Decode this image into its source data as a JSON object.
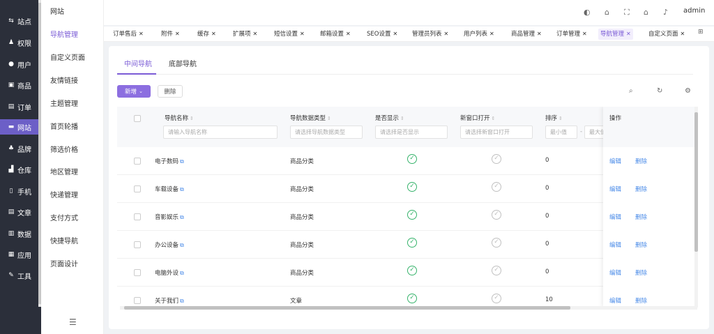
{
  "rail": {
    "items": [
      {
        "icon": "site-icon",
        "glyph": "⇆",
        "label": "站点"
      },
      {
        "icon": "permission-icon",
        "glyph": "♟",
        "label": "权限"
      },
      {
        "icon": "user-icon",
        "glyph": "●",
        "label": "用户"
      },
      {
        "icon": "product-icon",
        "glyph": "▣",
        "label": "商品"
      },
      {
        "icon": "order-icon",
        "glyph": "▤",
        "label": "订单"
      },
      {
        "icon": "website-icon",
        "glyph": "▬",
        "label": "网站"
      },
      {
        "icon": "brand-icon",
        "glyph": "♣",
        "label": "品牌"
      },
      {
        "icon": "warehouse-icon",
        "glyph": "▟",
        "label": "仓库"
      },
      {
        "icon": "mobile-icon",
        "glyph": "▯",
        "label": "手机"
      },
      {
        "icon": "article-icon",
        "glyph": "▤",
        "label": "文章"
      },
      {
        "icon": "data-icon",
        "glyph": "▥",
        "label": "数据"
      },
      {
        "icon": "app-icon",
        "glyph": "▦",
        "label": "应用"
      },
      {
        "icon": "tool-icon",
        "glyph": "✎",
        "label": "工具"
      }
    ],
    "active": "网站"
  },
  "submenu": {
    "items": [
      "网站",
      "导航管理",
      "自定义页面",
      "友情链接",
      "主题管理",
      "首页轮播",
      "筛选价格",
      "地区管理",
      "快递管理",
      "支付方式",
      "快捷导航",
      "页面设计"
    ],
    "active": "导航管理"
  },
  "header": {
    "user": "admin"
  },
  "tabs": {
    "items": [
      "订单售后",
      "附件",
      "缓存",
      "扩展项",
      "短信设置",
      "邮箱设置",
      "SEO设置",
      "管理员列表",
      "用户列表",
      "商品管理",
      "订单管理",
      "导航管理",
      "自定义页面"
    ],
    "active": "导航管理",
    "close_glyph": "✕"
  },
  "page": {
    "subtabs": [
      "中间导航",
      "底部导航"
    ],
    "add_label": "新增",
    "delete_label": "删除"
  },
  "table": {
    "columns": {
      "name": "导航名称",
      "type": "导航数据类型",
      "show": "是否显示",
      "new_window": "新窗口打开",
      "sort": "排序",
      "ops": "操作"
    },
    "filters": {
      "name_placeholder": "请输入导航名称",
      "type_placeholder": "请选择导航数据类型",
      "show_placeholder": "请选择是否显示",
      "new_window_placeholder": "请选择新窗口打开",
      "sort_min": "最小值",
      "sort_sep": "-",
      "sort_max": "最大值"
    },
    "rows": [
      {
        "name": "电子数码",
        "type": "商品分类",
        "show": true,
        "new_window": false,
        "sort": "0"
      },
      {
        "name": "车载设备",
        "type": "商品分类",
        "show": true,
        "new_window": false,
        "sort": "0"
      },
      {
        "name": "音影娱乐",
        "type": "商品分类",
        "show": true,
        "new_window": false,
        "sort": "0"
      },
      {
        "name": "办公设备",
        "type": "商品分类",
        "show": true,
        "new_window": false,
        "sort": "0"
      },
      {
        "name": "电脑外设",
        "type": "商品分类",
        "show": true,
        "new_window": false,
        "sort": "0"
      },
      {
        "name": "关于我们",
        "type": "文章",
        "show": true,
        "new_window": false,
        "sort": "10"
      }
    ],
    "edit_label": "编辑",
    "delete_label": "删除"
  }
}
